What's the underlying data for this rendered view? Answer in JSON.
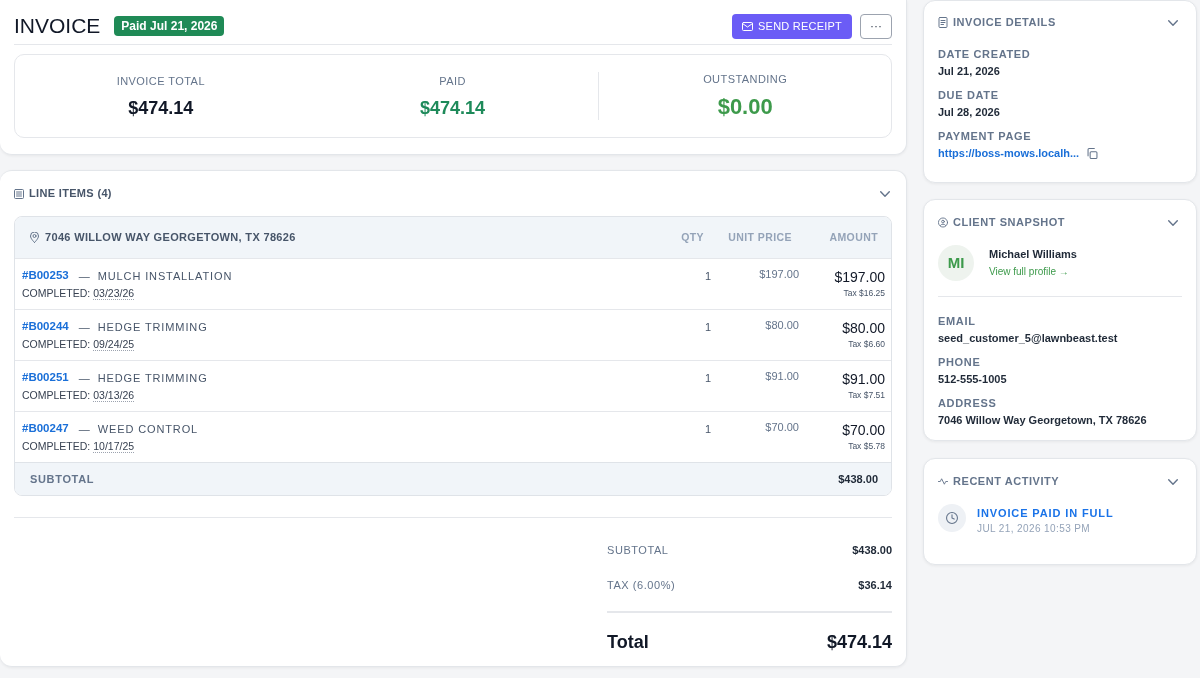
{
  "header": {
    "title": "INVOICE",
    "status_badge": "Paid Jul 21, 2026",
    "actions": [
      {
        "kind": "primary",
        "label": "SEND RECEIPT"
      },
      {
        "kind": "more",
        "label": "···"
      }
    ]
  },
  "summary": [
    {
      "kind": "neutral",
      "label": "INVOICE TOTAL",
      "value": "$474.14"
    },
    {
      "kind": "positive",
      "label": "PAID",
      "value": "$474.14"
    },
    {
      "kind": "highlight",
      "label": "OUTSTANDING",
      "value": "$0.00"
    }
  ],
  "line_items": {
    "title": "LINE ITEMS (4)",
    "location": "7046 WILLOW WAY GEORGETOWN, TX 78626",
    "columns": [
      "QTY",
      "UNIT PRICE",
      "AMOUNT"
    ],
    "rows": [
      {
        "code": "#B00253",
        "separator": "—",
        "service": "MULCH INSTALLATION",
        "completed_label": "COMPLETED:",
        "completed_date": "03/23/26",
        "qty": "1",
        "unit_price": "$197.00",
        "amount": "$197.00",
        "tax": "Tax $16.25"
      },
      {
        "code": "#B00244",
        "separator": "—",
        "service": "HEDGE TRIMMING",
        "completed_label": "COMPLETED:",
        "completed_date": "09/24/25",
        "qty": "1",
        "unit_price": "$80.00",
        "amount": "$80.00",
        "tax": "Tax $6.60"
      },
      {
        "code": "#B00251",
        "separator": "—",
        "service": "HEDGE TRIMMING",
        "completed_label": "COMPLETED:",
        "completed_date": "03/13/26",
        "qty": "1",
        "unit_price": "$91.00",
        "amount": "$91.00",
        "tax": "Tax $7.51"
      },
      {
        "code": "#B00247",
        "separator": "—",
        "service": "WEED CONTROL",
        "completed_label": "COMPLETED:",
        "completed_date": "10/17/25",
        "qty": "1",
        "unit_price": "$70.00",
        "amount": "$70.00",
        "tax": "Tax $5.78"
      }
    ],
    "subtotal": {
      "label": "SUBTOTAL",
      "value": "$438.00"
    }
  },
  "totals": {
    "rows": [
      {
        "label": "SUBTOTAL",
        "value": "$438.00"
      },
      {
        "label": "TAX (6.00%)",
        "value": "$36.14"
      }
    ],
    "grand": {
      "label": "Total",
      "value": "$474.14"
    }
  },
  "invoice_details": {
    "title": "INVOICE DETAILS",
    "fields": [
      {
        "kind": "text",
        "label": "DATE CREATED",
        "value": "Jul 21, 2026"
      },
      {
        "kind": "text",
        "label": "DUE DATE",
        "value": "Jul 28, 2026"
      },
      {
        "kind": "link",
        "label": "PAYMENT PAGE",
        "value": "https://boss-mows.localh..."
      }
    ]
  },
  "client_snapshot": {
    "title": "CLIENT SNAPSHOT",
    "initials": "MI",
    "name": "Michael Williams",
    "profile_link": "View full profile →",
    "fields": [
      {
        "label": "EMAIL",
        "value": "seed_customer_5@lawnbeast.test"
      },
      {
        "label": "PHONE",
        "value": "512-555-1005"
      },
      {
        "label": "ADDRESS",
        "value": "7046 Willow Way Georgetown, TX 78626"
      }
    ]
  },
  "recent_activity": {
    "title": "RECENT ACTIVITY",
    "items": [
      {
        "title": "INVOICE PAID IN FULL",
        "time": "JUL 21, 2026 10:53 PM"
      }
    ]
  }
}
